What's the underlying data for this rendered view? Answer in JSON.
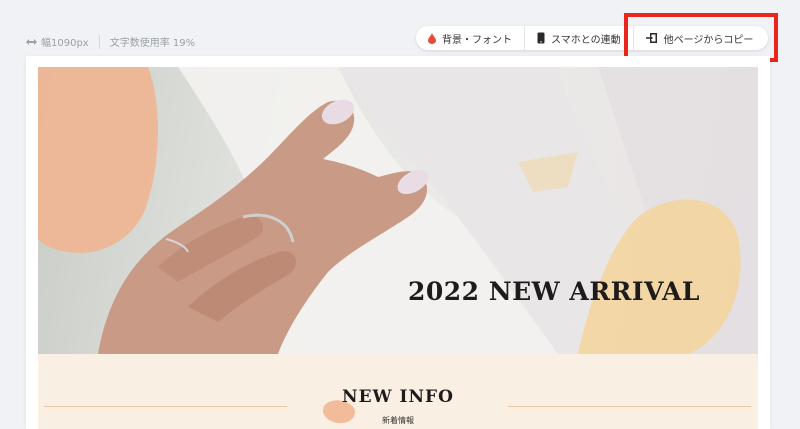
{
  "meta": {
    "width_label": "幅1090px",
    "char_ratio_label": "文字数使用率 19%"
  },
  "toolbar": {
    "background_font": {
      "label": "背景・フォント",
      "icon": "drop-icon"
    },
    "smartphone_sync": {
      "label": "スマホとの連動",
      "icon": "smartphone-icon"
    },
    "copy_from_page": {
      "label": "他ページからコピー",
      "icon": "copy-import-icon"
    }
  },
  "hero": {
    "title": "2022 NEW ARRIVAL"
  },
  "info": {
    "title": "NEW INFO",
    "subtitle": "新着情報"
  },
  "colors": {
    "highlight": "#e8261c",
    "drop": "#e84a3a",
    "info_bg": "#faefe3"
  }
}
